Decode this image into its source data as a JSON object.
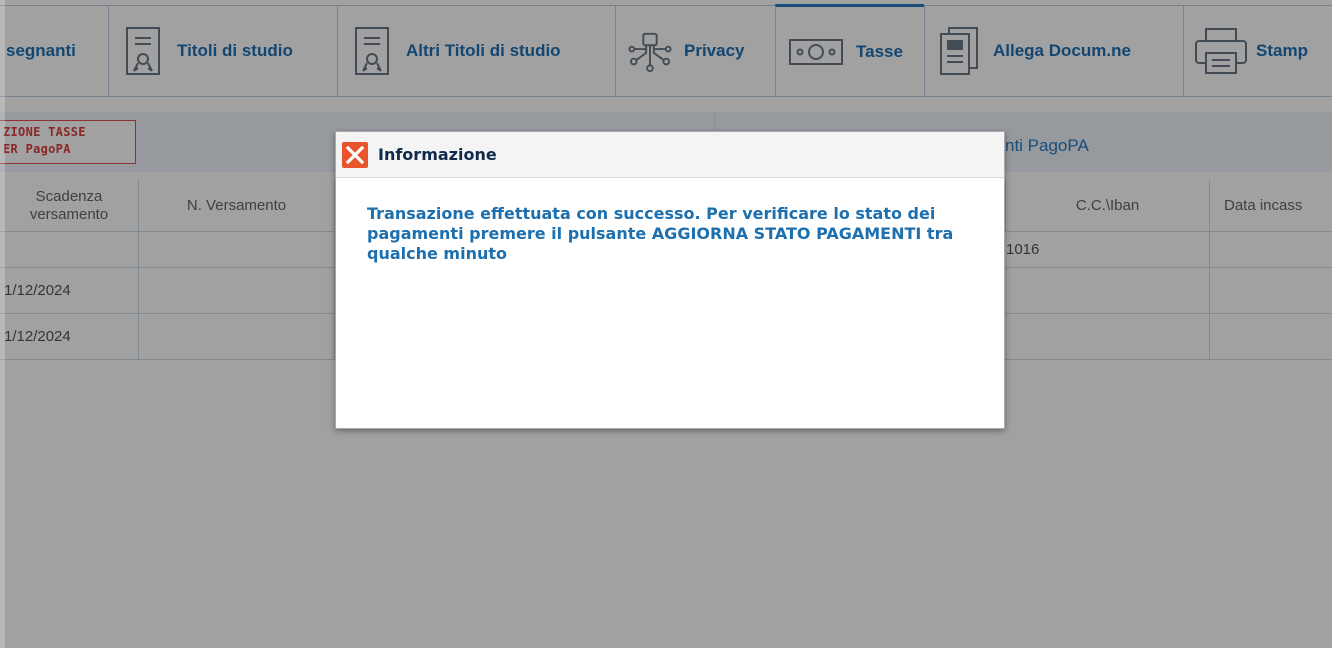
{
  "tabs": [
    {
      "label": "segnanti",
      "icon": "none"
    },
    {
      "label": "Titoli di studio",
      "icon": "certificate-icon"
    },
    {
      "label": "Altri Titoli di studio",
      "icon": "certificate-icon"
    },
    {
      "label": "Privacy",
      "icon": "circuit-icon"
    },
    {
      "label": "Tasse",
      "icon": "banknote-icon",
      "active": true
    },
    {
      "label": "Allega Docum.ne",
      "icon": "document-icon"
    },
    {
      "label": "Stamp",
      "icon": "printer-icon"
    }
  ],
  "stamp": {
    "line1": "ZIONE TASSE",
    "line2": "ER PagoPA"
  },
  "pagopa_title": "nti PagoPA",
  "table": {
    "headers": [
      "Scadenza versamento",
      "N. Versamento",
      "C.C.\\Iban",
      "Data incass"
    ],
    "rows": [
      {
        "scadenza": "",
        "iban": "1016"
      },
      {
        "scadenza": "1/12/2024",
        "iban": ""
      },
      {
        "scadenza": "1/12/2024",
        "iban": ""
      }
    ]
  },
  "dialog": {
    "title": "Informazione",
    "message": "Transazione effettuata con successo. Per verificare lo stato dei pagamenti premere il pulsante AGGIORNA STATO PAGAMENTI tra qualche minuto",
    "icon": "close-icon",
    "icon_color": "#e8542b"
  },
  "colors": {
    "accent": "#1f6fb2",
    "dialog_text": "#1d6fae",
    "stamp": "#d94040"
  }
}
